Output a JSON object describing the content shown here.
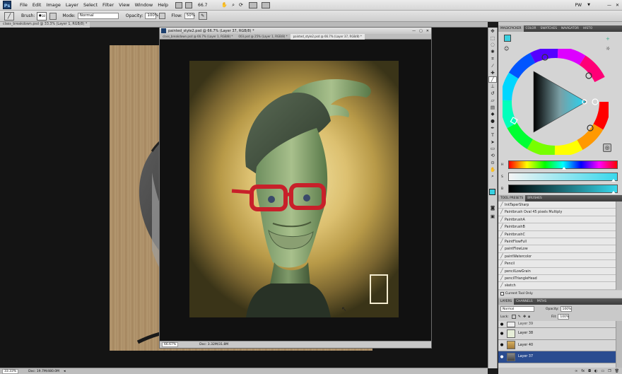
{
  "app": {
    "logo": "Ps",
    "window_title": "PW"
  },
  "menu": [
    "File",
    "Edit",
    "Image",
    "Layer",
    "Select",
    "Filter",
    "View",
    "Window",
    "Help"
  ],
  "menu_right": {
    "zoom": "66.7"
  },
  "options": {
    "brush_label": "Brush:",
    "brush_size": "18",
    "mode_label": "Mode:",
    "mode_value": "Normal",
    "opacity_label": "Opacity:",
    "opacity_value": "100%",
    "flow_label": "Flow:",
    "flow_value": "50%"
  },
  "doc_tab": "class_breakdown.psd @ 33.3% (Layer 1, RGB/8) *",
  "front_window": {
    "title": "painted_style2.psd @ 66.7% (Layer 37, RGB/8) *",
    "tabs": [
      "class_breakdown.psd @ 66.7% (Layer 1, RGB/8) *",
      "003.psd @ 25% (Layer 1, RGB/8) *",
      "painted_style2.psd @ 66.7% (Layer 37, RGB/8) *"
    ],
    "status_zoom": "66.67%",
    "status_doc": "Doc: 3.32M/31.8M"
  },
  "status": {
    "zoom": "33.33%",
    "doc": "Doc: 19.7M/480.0M"
  },
  "color_panel": {
    "tabs": [
      "MAGICPICKER",
      "COLOR",
      "SWATCHES",
      "NAVIGATOR",
      "HISTO"
    ],
    "hsb_labels": [
      "H",
      "S",
      "B"
    ],
    "hue_pos": 0.51,
    "sat_pos": 0.97,
    "bri_pos": 0.97
  },
  "tool_presets": {
    "tabs": [
      "TOOL PRESETS",
      "BRUSHES"
    ],
    "items": [
      "InkTaperSharp",
      "Paintbrush Oval 45 pixels Multiply",
      "PaintbrushA",
      "PaintbrushB",
      "PaintbrushC",
      "PaintFlowFull",
      "paintFlowLow",
      "paintWatercolor",
      "Pencil",
      "pencilLowGrain",
      "pencilTriangleHead",
      "sketch"
    ],
    "current_only": "Current Tool Only"
  },
  "layers_panel": {
    "tabs": [
      "LAYERS",
      "CHANNELS",
      "PATHS"
    ],
    "blend_mode": "Normal",
    "opacity_label": "Opacity:",
    "opacity_value": "100%",
    "lock_label": "Lock:",
    "fill_label": "Fill:",
    "fill_value": "100%",
    "layers": [
      {
        "name": "Layer 39",
        "selected": false
      },
      {
        "name": "Layer 38",
        "selected": false
      },
      {
        "name": "Layer 40",
        "selected": false
      },
      {
        "name": "Layer 37",
        "selected": true
      }
    ]
  },
  "colors": {
    "foreground": "#38d0e0",
    "selection": "#2a4c90"
  },
  "icons": [
    "move-icon",
    "marquee-icon",
    "lasso-icon",
    "quick-select-icon",
    "crop-icon",
    "eyedropper-icon",
    "healing-icon",
    "brush-icon",
    "clone-stamp-icon",
    "history-brush-icon",
    "eraser-icon",
    "gradient-icon",
    "blur-icon",
    "dodge-icon",
    "pen-icon",
    "type-icon",
    "path-select-icon",
    "shape-icon",
    "3d-rotate-icon",
    "3d-orbit-icon",
    "hand-icon",
    "zoom-icon"
  ]
}
